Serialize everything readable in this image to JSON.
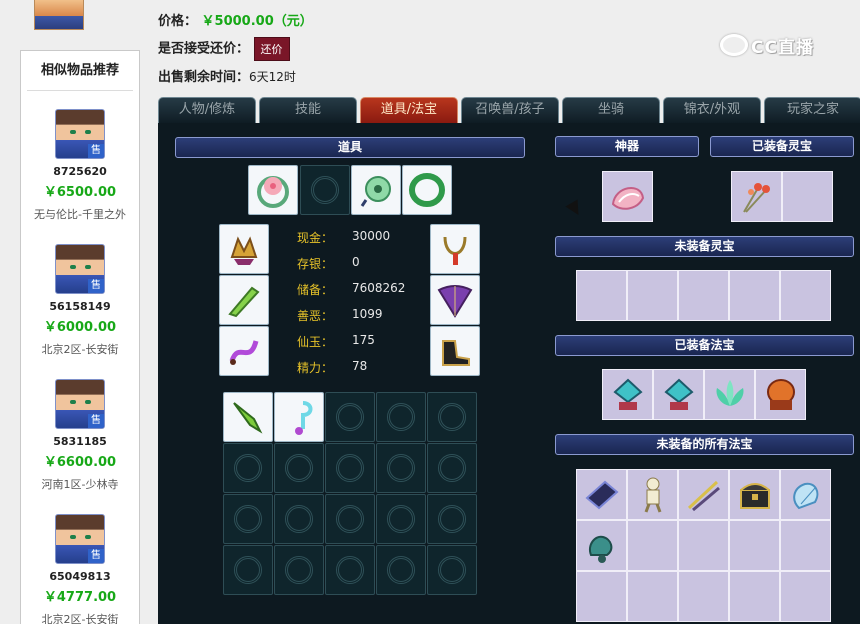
{
  "colors": {
    "price": "#17a817",
    "active_tab": "#b8361d",
    "counter_button": "#7a1628"
  },
  "listing": {
    "price_label": "价格：",
    "price_value": "￥5000.00（元）",
    "counter_label": "是否接受还价：",
    "counter_button": "还价",
    "time_label": "出售剩余时间：",
    "time_value": "6天12时"
  },
  "watermark": {
    "text": "CC直播"
  },
  "sidebar": {
    "title": "相似物品推荐",
    "items": [
      {
        "id": "8725620",
        "price": "￥6500.00",
        "server": "无与伦比-千里之外",
        "badge": "售"
      },
      {
        "id": "56158149",
        "price": "￥6000.00",
        "server": "北京2区-长安街",
        "badge": "售"
      },
      {
        "id": "5831185",
        "price": "￥6600.00",
        "server": "河南1区-少林寺",
        "badge": "售"
      },
      {
        "id": "65049813",
        "price": "￥4777.00",
        "server": "北京2区-长安街",
        "badge": "售"
      }
    ]
  },
  "tabs": [
    {
      "label": "人物/修炼",
      "active": false
    },
    {
      "label": "技能",
      "active": false
    },
    {
      "label": "道具/法宝",
      "active": true
    },
    {
      "label": "召唤兽/孩子",
      "active": false
    },
    {
      "label": "坐骑",
      "active": false
    },
    {
      "label": "锦衣/外观",
      "active": false
    },
    {
      "label": "玩家之家",
      "active": false
    }
  ],
  "items_panel": {
    "title": "道具",
    "stats": [
      {
        "label": "现金：",
        "value": "30000"
      },
      {
        "label": "存银：",
        "value": "0"
      },
      {
        "label": "储备：",
        "value": "7608262"
      },
      {
        "label": "善恶：",
        "value": "1099"
      },
      {
        "label": "仙玉：",
        "value": "175"
      },
      {
        "label": "精力：",
        "value": "78"
      }
    ],
    "top_slots": [
      "flower-ring-icon",
      "empty",
      "jade-pendant-icon",
      "jade-bracelet-icon"
    ],
    "left_equipment": [
      "helmet-icon",
      "green-blade-icon",
      "purple-whip-icon"
    ],
    "right_equipment": [
      "tassel-necklace-icon",
      "feather-fan-icon",
      "black-boots-icon"
    ],
    "inventory_items": [
      "green-dagger-icon",
      "cyan-hook-icon"
    ]
  },
  "artifact_panel": {
    "artifact_title": "神器",
    "equipped_spirit_title": "已装备灵宝",
    "unequipped_spirit_title": "未装备灵宝",
    "equipped_treasure_title": "已装备法宝",
    "all_unequipped_title": "未装备的所有法宝"
  }
}
